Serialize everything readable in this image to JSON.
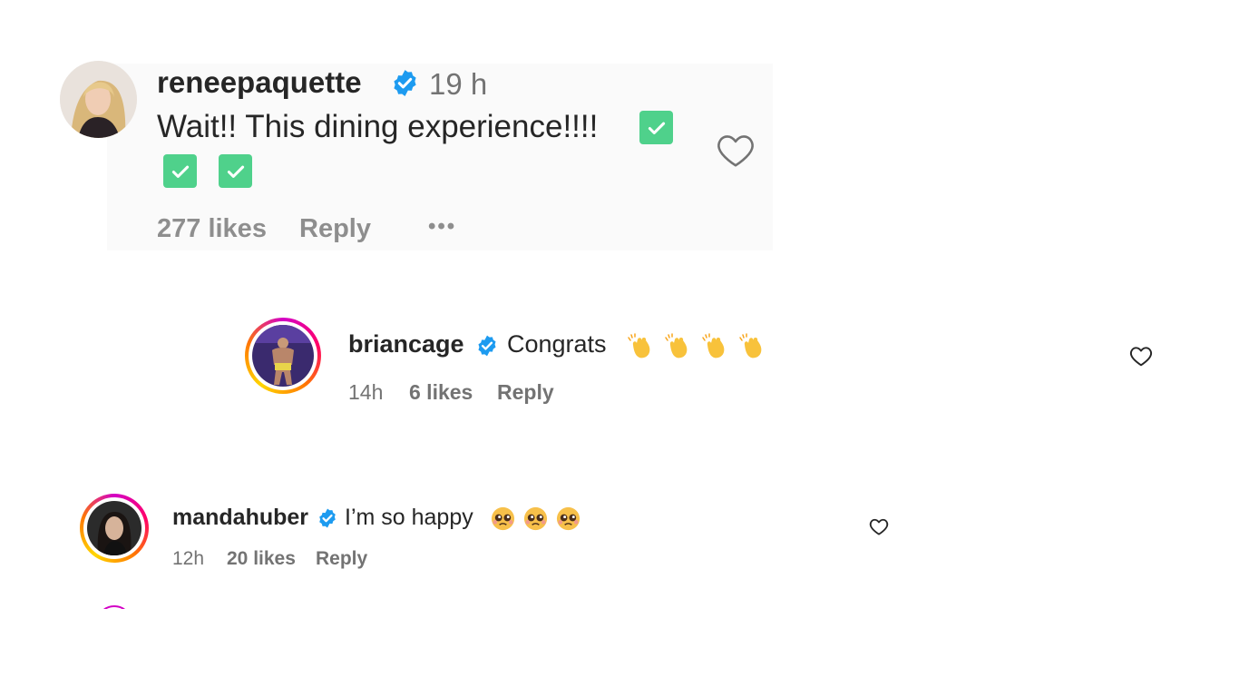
{
  "comments": [
    {
      "username": "reneepaquette",
      "time": "19 h",
      "text_line1": "Wait!! This dining experience!!!!",
      "text_line2": "",
      "likes": "277 likes",
      "reply": "Reply",
      "more": "•••",
      "icons": [
        "verified-badge-icon",
        "check-emoji-icon",
        "heart-outline-icon",
        "more-options-icon"
      ]
    },
    {
      "username": "briancage",
      "text": "Congrats",
      "time": "14h",
      "likes": "6 likes",
      "reply": "Reply",
      "icons": [
        "verified-badge-icon",
        "clap-emoji-icon",
        "heart-outline-icon"
      ]
    },
    {
      "username": "mandahuber",
      "text": "I’m so happy",
      "time": "12h",
      "likes": "20 likes",
      "reply": "Reply",
      "icons": [
        "verified-badge-icon",
        "pleading-face-emoji-icon",
        "heart-outline-icon"
      ]
    }
  ],
  "colors": {
    "verified": "#1d9bf0",
    "check": "#4fd18b",
    "muted": "#737373",
    "text": "#262626"
  }
}
